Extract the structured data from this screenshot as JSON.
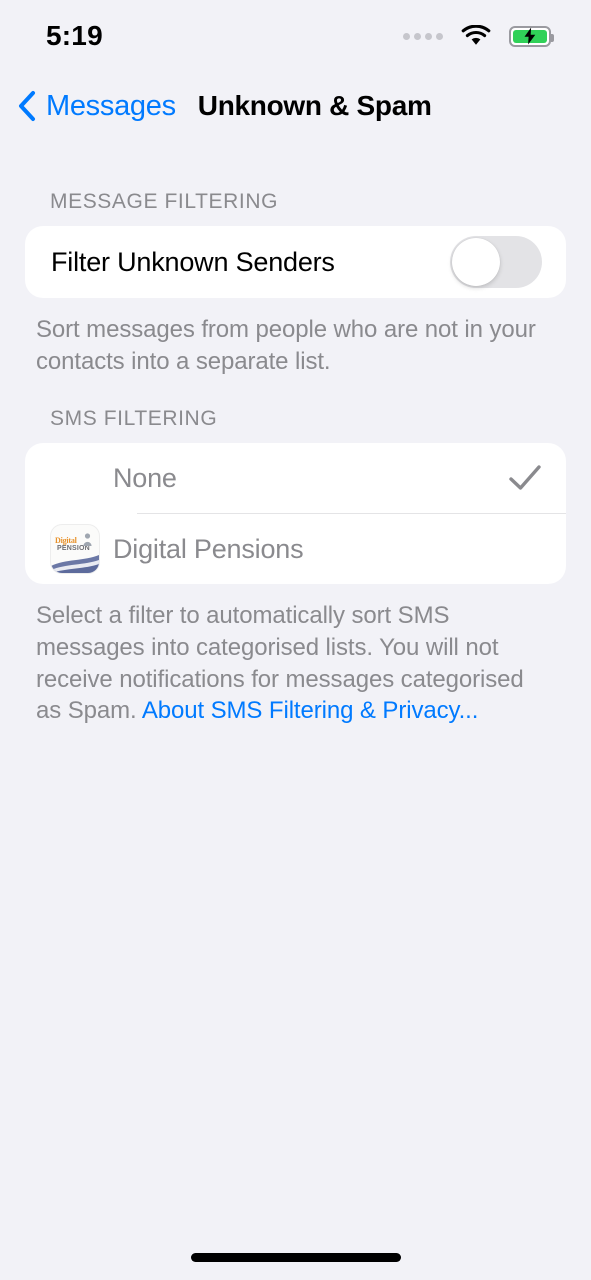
{
  "status_bar": {
    "time": "5:19",
    "signal_icon": "signal-dots-icon",
    "wifi_icon": "wifi-icon",
    "battery_icon": "battery-charging-icon",
    "battery_color": "#30D158"
  },
  "nav": {
    "back_icon": "chevron-left-icon",
    "back_label": "Messages",
    "title": "Unknown & Spam",
    "accent_color": "#007AFF"
  },
  "sections": {
    "message_filtering": {
      "header": "MESSAGE FILTERING",
      "row_label": "Filter Unknown Senders",
      "toggle_state": "off",
      "footer": "Sort messages from people who are not in your contacts into a separate list."
    },
    "sms_filtering": {
      "header": "SMS FILTERING",
      "items": [
        {
          "label": "None",
          "selected": true,
          "check_icon": "checkmark-icon",
          "has_icon": false
        },
        {
          "label": "Digital Pensions",
          "selected": false,
          "has_icon": true,
          "app_icon_name": "digital-pension-app-icon",
          "app_icon_text_top": "Digital",
          "app_icon_text_bottom": "PENSION"
        }
      ],
      "footer": "Select a filter to automatically sort SMS messages into categorised lists. You will not receive notifications for messages categorised as Spam.",
      "footer_link": "About SMS Filtering & Privacy..."
    }
  },
  "home_indicator": "home-indicator"
}
